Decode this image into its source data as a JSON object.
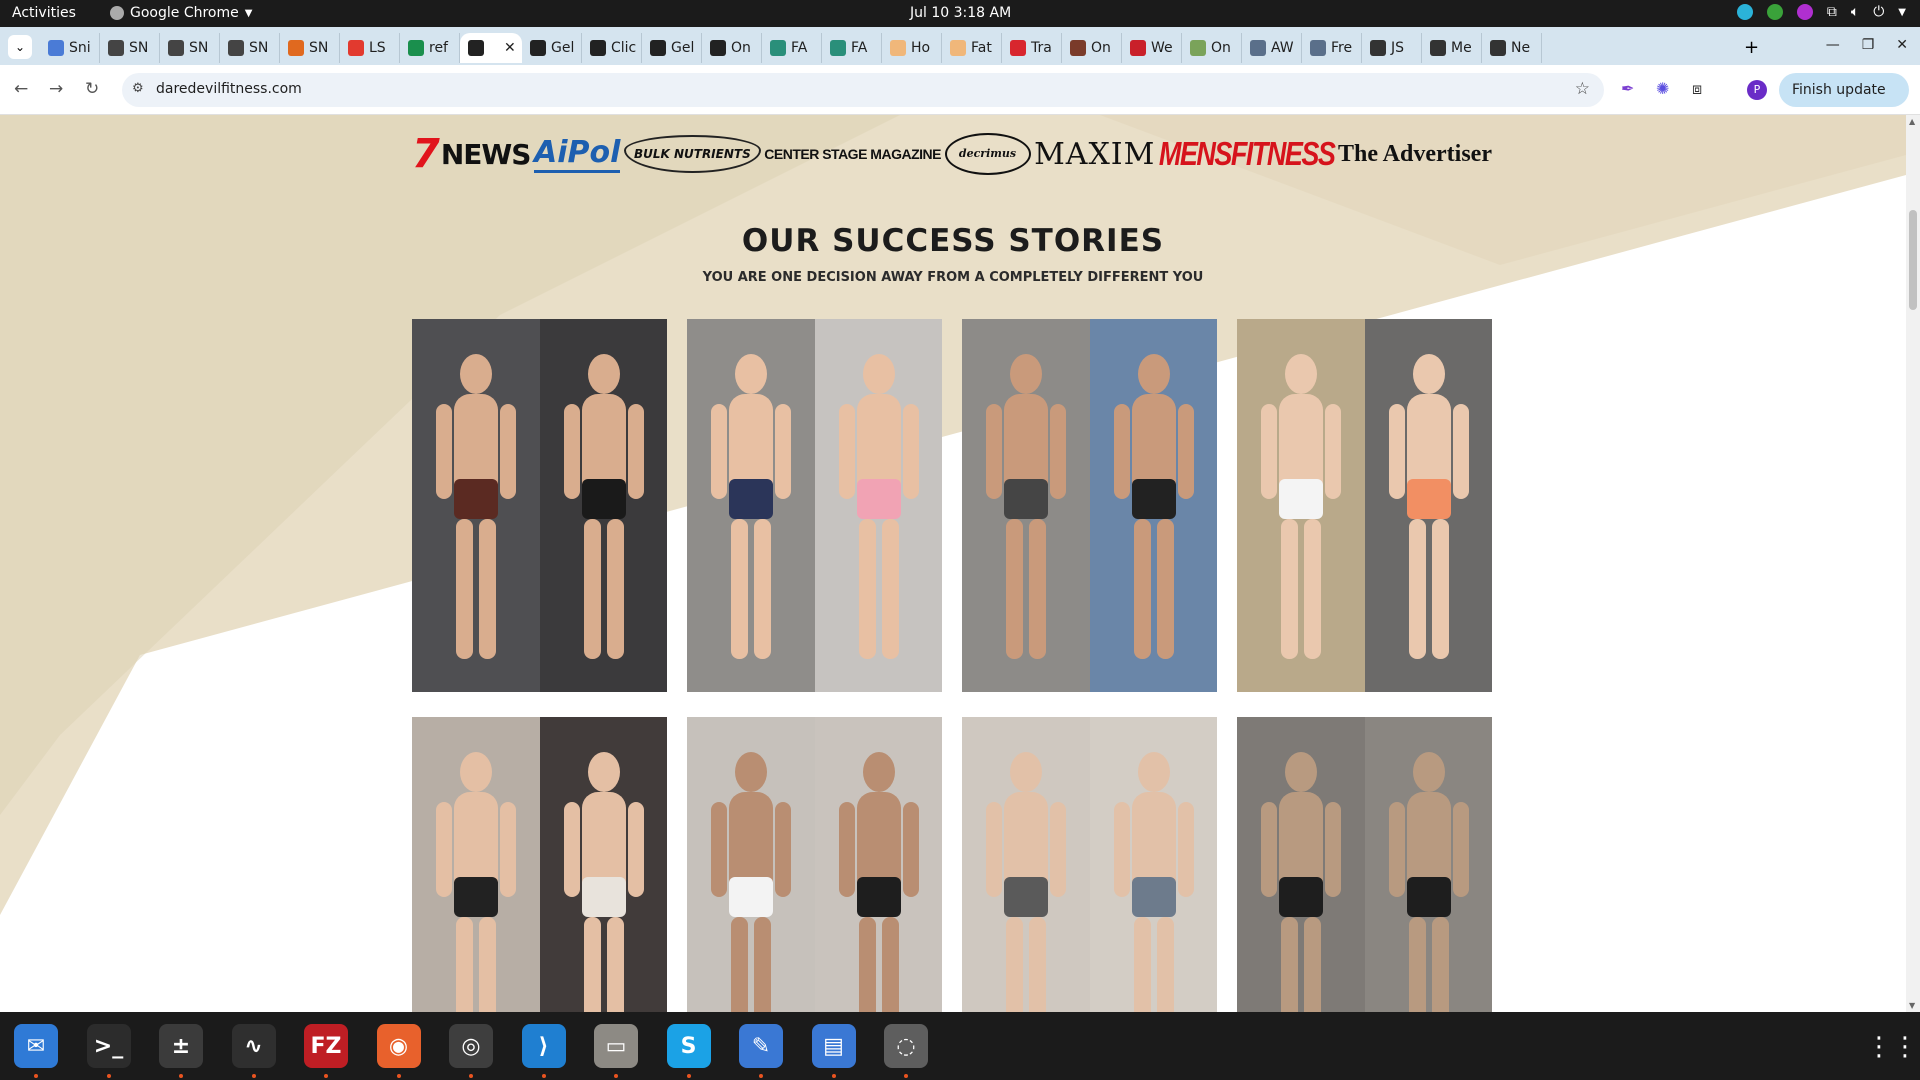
{
  "topbar": {
    "activities": "Activities",
    "app": "Google Chrome",
    "clock": "Jul 10  3:18 AM"
  },
  "tabs": [
    {
      "label": "Sni",
      "color": "#4a7bd6"
    },
    {
      "label": "SN",
      "color": "#444"
    },
    {
      "label": "SN",
      "color": "#444"
    },
    {
      "label": "SN",
      "color": "#444"
    },
    {
      "label": "SN",
      "color": "#e0691f"
    },
    {
      "label": "LS",
      "color": "#e23a2f"
    },
    {
      "label": "ref",
      "color": "#1a8f4d"
    },
    {
      "label": "",
      "color": "#222",
      "active": true
    },
    {
      "label": "Gel",
      "color": "#222"
    },
    {
      "label": "Clic",
      "color": "#222"
    },
    {
      "label": "Gel",
      "color": "#222"
    },
    {
      "label": "On",
      "color": "#222"
    },
    {
      "label": "FA",
      "color": "#2a8f7a"
    },
    {
      "label": "FA",
      "color": "#2a8f7a"
    },
    {
      "label": "Ho",
      "color": "#f0b77a"
    },
    {
      "label": "Fat",
      "color": "#f0b77a"
    },
    {
      "label": "Tra",
      "color": "#d8262e"
    },
    {
      "label": "On",
      "color": "#7a3b2a"
    },
    {
      "label": "We",
      "color": "#c9202a"
    },
    {
      "label": "On",
      "color": "#7aa35a"
    },
    {
      "label": "AW",
      "color": "#5a6f8a"
    },
    {
      "label": "Fre",
      "color": "#5a6f8a"
    },
    {
      "label": "JS",
      "color": "#333"
    },
    {
      "label": "Me",
      "color": "#333"
    },
    {
      "label": "Ne",
      "color": "#333"
    }
  ],
  "address": {
    "url": "daredevilfitness.com",
    "finish_update": "Finish update",
    "avatar_letter": "P"
  },
  "page": {
    "logos": [
      "NEWS",
      "AiPol",
      "BULK NUTRIENTS",
      "CENTER STAGE MAGAZINE",
      "decrimus",
      "MAXIM",
      "MENSFITNESS",
      "The Advertiser"
    ],
    "heading": "OUR SUCCESS STORIES",
    "subheading": "YOU ARE ONE DECISION AWAY FROM A COMPLETELY DIFFERENT YOU"
  },
  "stories": [
    {
      "before_bg": "#4f4f52",
      "after_bg": "#3b3a3c",
      "skin": "#d9ad8e",
      "wear": "#5b2a22",
      "wear2": "#1a1a1a"
    },
    {
      "before_bg": "#8f8d8a",
      "after_bg": "#c6c3c0",
      "skin": "#e8c0a3",
      "wear": "#2b3559",
      "wear2": "#f1a3b4"
    },
    {
      "before_bg": "#8d8b88",
      "after_bg": "#6a86a8",
      "skin": "#c99a7b",
      "wear": "#454545",
      "wear2": "#222222"
    },
    {
      "before_bg": "#b9a98a",
      "after_bg": "#6b6a69",
      "skin": "#eac8ae",
      "wear": "#f4f4f4",
      "wear2": "#f28f63"
    },
    {
      "before_bg": "#b7aea5",
      "after_bg": "#413b3a",
      "skin": "#e4bfa4",
      "wear": "#222222",
      "wear2": "#e8e3dc"
    },
    {
      "before_bg": "#c6c1bb",
      "after_bg": "#c9c3bd",
      "skin": "#b98e72",
      "wear": "#f3f3f3",
      "wear2": "#1e1e1e"
    },
    {
      "before_bg": "#cfc8c0",
      "after_bg": "#d3cdc5",
      "skin": "#e2c1a8",
      "wear": "#5a5a5a",
      "wear2": "#6d7b8c"
    },
    {
      "before_bg": "#7e7a76",
      "after_bg": "#8a8681",
      "skin": "#b89a80",
      "wear": "#1e1e1e",
      "wear2": "#1e1e1e"
    }
  ],
  "dock": [
    {
      "name": "thunderbird",
      "color": "#2f7ad6",
      "glyph": "✉"
    },
    {
      "name": "terminal",
      "color": "#2c2c2c",
      "glyph": ">_"
    },
    {
      "name": "calculator",
      "color": "#3b3b3b",
      "glyph": "±"
    },
    {
      "name": "system-monitor",
      "color": "#2f2f2f",
      "glyph": "∿"
    },
    {
      "name": "filezilla",
      "color": "#bf1e24",
      "glyph": "FZ"
    },
    {
      "name": "firefox",
      "color": "#e8612c",
      "glyph": "◉"
    },
    {
      "name": "chrome",
      "color": "#3e3e3e",
      "glyph": "◎"
    },
    {
      "name": "vscode",
      "color": "#1f7fd1",
      "glyph": "⟩"
    },
    {
      "name": "files",
      "color": "#8d8a84",
      "glyph": "▭"
    },
    {
      "name": "skype",
      "color": "#1ba2e6",
      "glyph": "S"
    },
    {
      "name": "text-editor",
      "color": "#3a78d4",
      "glyph": "✎"
    },
    {
      "name": "document-viewer",
      "color": "#3a78d4",
      "glyph": "▤"
    },
    {
      "name": "disc",
      "color": "#5e5e5e",
      "glyph": "◌"
    }
  ]
}
